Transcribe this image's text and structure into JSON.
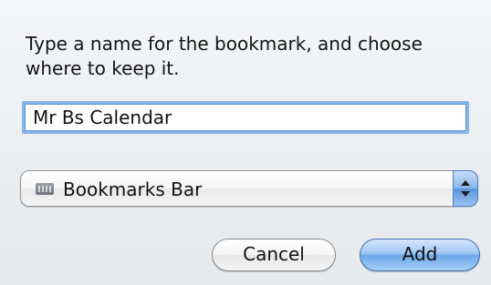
{
  "dialog": {
    "prompt": "Type a name for the bookmark, and choose where to keep it.",
    "name_value": "Mr Bs Calendar",
    "location": {
      "selected": "Bookmarks Bar",
      "icon": "bookmarks-bar-icon"
    },
    "buttons": {
      "cancel": "Cancel",
      "add": "Add"
    }
  },
  "colors": {
    "accent_blue": "#6ea7e8",
    "focus_ring": "#86b4e6"
  }
}
